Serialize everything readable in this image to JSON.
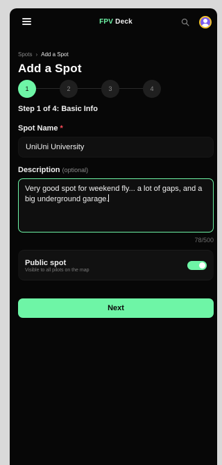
{
  "header": {
    "brand_fpv": "FPV",
    "brand_deck": "Deck",
    "menu_icon": "hamburger-menu-icon",
    "search_icon": "search-icon",
    "avatar_icon": "user-avatar-icon"
  },
  "breadcrumb": {
    "parent": "Spots",
    "separator": "›",
    "current": "Add a Spot"
  },
  "page_title": "Add a Spot",
  "stepper": {
    "steps": [
      "1",
      "2",
      "3",
      "4"
    ],
    "active_index": 0,
    "caption": "Step 1 of 4: Basic Info"
  },
  "form": {
    "name_label": "Spot Name",
    "name_required_marker": "*",
    "name_value": "UniUni University",
    "description_label": "Description",
    "description_optional": "(optional)",
    "description_value": "Very good spot for weekend fly... a lot of gaps, and a big underground garage.",
    "char_count": "78/500",
    "public_title": "Public spot",
    "public_subtitle": "Visible to all pilots on the map",
    "public_enabled": true,
    "next_label": "Next"
  },
  "colors": {
    "accent": "#6ef5a6",
    "background": "#070707",
    "required": "#ff4d5a"
  }
}
